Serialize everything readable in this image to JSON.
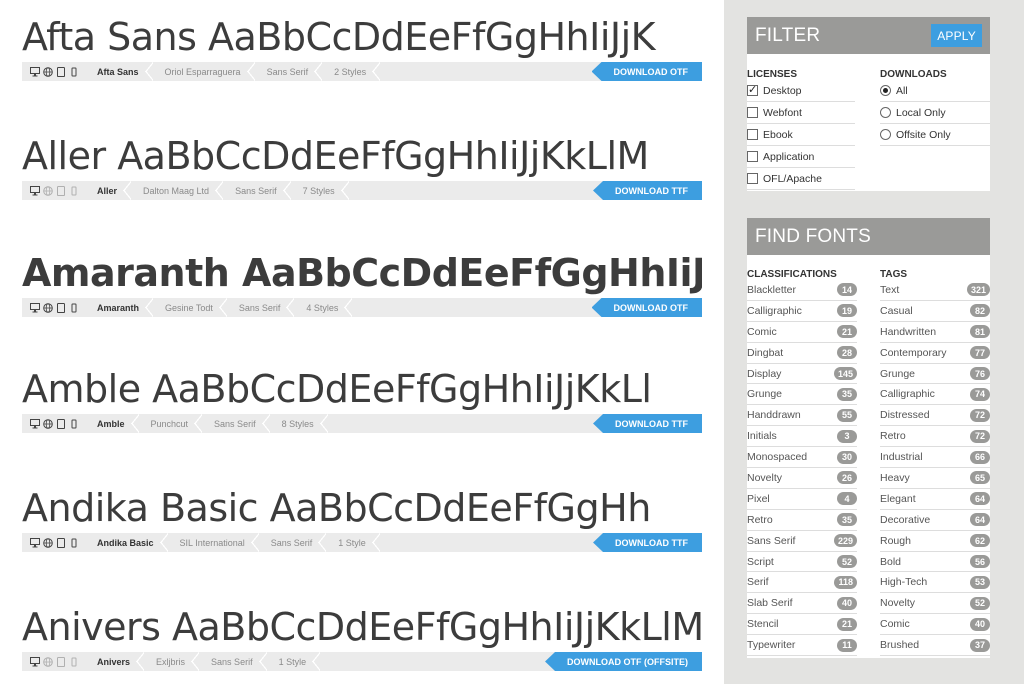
{
  "fonts": [
    {
      "name": "Afta Sans",
      "sample": "Afta Sans AaBbCcDdEeFfGgHhIiJjK",
      "designer": "Oriol Esparraguera",
      "classification": "Sans Serif",
      "styles": "2 Styles",
      "download": "DOWNLOAD OTF",
      "all_platforms": true
    },
    {
      "name": "Aller",
      "sample": "Aller AaBbCcDdEeFfGgHhIiJjKkLlM",
      "designer": "Dalton Maag Ltd",
      "classification": "Sans Serif",
      "styles": "7 Styles",
      "download": "DOWNLOAD TTF",
      "all_platforms": false
    },
    {
      "name": "Amaranth",
      "sample": "Amaranth AaBbCcDdEeFfGgHhIiJjKkL",
      "designer": "Gesine Todt",
      "classification": "Sans Serif",
      "styles": "4 Styles",
      "download": "DOWNLOAD OTF",
      "all_platforms": true
    },
    {
      "name": "Amble",
      "sample": "Amble AaBbCcDdEeFfGgHhIiJjKkLl",
      "designer": "Punchcut",
      "classification": "Sans Serif",
      "styles": "8 Styles",
      "download": "DOWNLOAD TTF",
      "all_platforms": true
    },
    {
      "name": "Andika Basic",
      "sample": "Andika Basic AaBbCcDdEeFfGgHh",
      "designer": "SIL International",
      "classification": "Sans Serif",
      "styles": "1 Style",
      "download": "DOWNLOAD TTF",
      "all_platforms": true
    },
    {
      "name": "Anivers",
      "sample": "Anivers AaBbCcDdEeFfGgHhIiJjKkLlM",
      "designer": "Exljbris",
      "classification": "Sans Serif",
      "styles": "1 Style",
      "download": "DOWNLOAD OTF (OFFSITE)",
      "all_platforms": false
    }
  ],
  "filter": {
    "title": "FILTER",
    "apply_label": "APPLY",
    "licenses_title": "LICENSES",
    "downloads_title": "DOWNLOADS",
    "licenses": [
      {
        "label": "Desktop",
        "checked": true
      },
      {
        "label": "Webfont",
        "checked": false
      },
      {
        "label": "Ebook",
        "checked": false
      },
      {
        "label": "Application",
        "checked": false
      },
      {
        "label": "OFL/Apache",
        "checked": false
      }
    ],
    "downloads": [
      {
        "label": "All",
        "checked": true
      },
      {
        "label": "Local Only",
        "checked": false
      },
      {
        "label": "Offsite Only",
        "checked": false
      }
    ]
  },
  "find_fonts": {
    "title": "FIND FONTS",
    "classifications_title": "CLASSIFICATIONS",
    "tags_title": "TAGS",
    "classifications": [
      {
        "label": "Blackletter",
        "count": "14"
      },
      {
        "label": "Calligraphic",
        "count": "19"
      },
      {
        "label": "Comic",
        "count": "21"
      },
      {
        "label": "Dingbat",
        "count": "28"
      },
      {
        "label": "Display",
        "count": "145"
      },
      {
        "label": "Grunge",
        "count": "35"
      },
      {
        "label": "Handdrawn",
        "count": "55"
      },
      {
        "label": "Initials",
        "count": "3"
      },
      {
        "label": "Monospaced",
        "count": "30"
      },
      {
        "label": "Novelty",
        "count": "26"
      },
      {
        "label": "Pixel",
        "count": "4"
      },
      {
        "label": "Retro",
        "count": "35"
      },
      {
        "label": "Sans Serif",
        "count": "229"
      },
      {
        "label": "Script",
        "count": "52"
      },
      {
        "label": "Serif",
        "count": "118"
      },
      {
        "label": "Slab Serif",
        "count": "40"
      },
      {
        "label": "Stencil",
        "count": "21"
      },
      {
        "label": "Typewriter",
        "count": "11"
      }
    ],
    "tags": [
      {
        "label": "Text",
        "count": "321"
      },
      {
        "label": "Casual",
        "count": "82"
      },
      {
        "label": "Handwritten",
        "count": "81"
      },
      {
        "label": "Contemporary",
        "count": "77"
      },
      {
        "label": "Grunge",
        "count": "76"
      },
      {
        "label": "Calligraphic",
        "count": "74"
      },
      {
        "label": "Distressed",
        "count": "72"
      },
      {
        "label": "Retro",
        "count": "72"
      },
      {
        "label": "Industrial",
        "count": "66"
      },
      {
        "label": "Heavy",
        "count": "65"
      },
      {
        "label": "Elegant",
        "count": "64"
      },
      {
        "label": "Decorative",
        "count": "64"
      },
      {
        "label": "Rough",
        "count": "62"
      },
      {
        "label": "Bold",
        "count": "56"
      },
      {
        "label": "High-Tech",
        "count": "53"
      },
      {
        "label": "Novelty",
        "count": "52"
      },
      {
        "label": "Comic",
        "count": "40"
      },
      {
        "label": "Brushed",
        "count": "37"
      }
    ]
  },
  "colors": {
    "accent": "#3d9ee0",
    "header_gray": "#9a9a98",
    "sidebar_bg": "#e3e3e1",
    "bar_bg": "#ebebeb"
  },
  "icons": [
    "desktop-icon",
    "globe-icon",
    "tablet-icon",
    "phone-icon"
  ]
}
